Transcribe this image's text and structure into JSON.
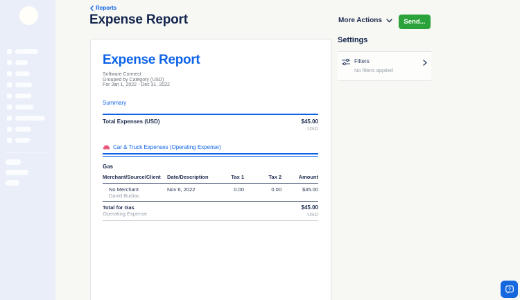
{
  "header": {
    "breadcrumb": "Reports",
    "title": "Expense Report",
    "more_actions_label": "More Actions",
    "send_label": "Send..."
  },
  "document": {
    "title": "Expense Report",
    "company": "Software Connect",
    "grouping": "Grouped by Category (USD)",
    "period": "For Jan 1, 2022 - Dec 31, 2022",
    "summary_link": "Summary",
    "total_label": "Total Expenses (USD)",
    "total_amount": "$45.00",
    "total_currency": "USD",
    "category": {
      "label": "Car & Truck Expenses (Operating Expense)",
      "icon": "car-icon"
    },
    "group": {
      "name": "Gas",
      "columns": [
        "Merchant/Source/Client",
        "Date/Description",
        "Tax 1",
        "Tax 2",
        "Amount"
      ],
      "rows": [
        {
          "merchant": "No Merchant",
          "client": "David Budiac",
          "date": "Nov 6, 2022",
          "tax1": "0.00",
          "tax2": "0.00",
          "amount": "$45.00"
        }
      ],
      "total_label": "Total for Gas",
      "total_sublabel": "Operating Expense",
      "total_amount": "$45.00",
      "total_currency": "USD"
    }
  },
  "settings": {
    "title": "Settings",
    "filters_label": "Filters",
    "filters_status": "No filters applied"
  },
  "help": {
    "glyph": "?"
  },
  "colors": {
    "accent_blue": "#0d63e8",
    "navy": "#13264d",
    "send_green": "#2ca33a",
    "sidebar_bg": "#e9eef9",
    "page_bg": "#f7f7f3",
    "car_pink": "#e8567a",
    "help_blue": "#1568dd",
    "muted_gray": "#9aa1ab"
  }
}
